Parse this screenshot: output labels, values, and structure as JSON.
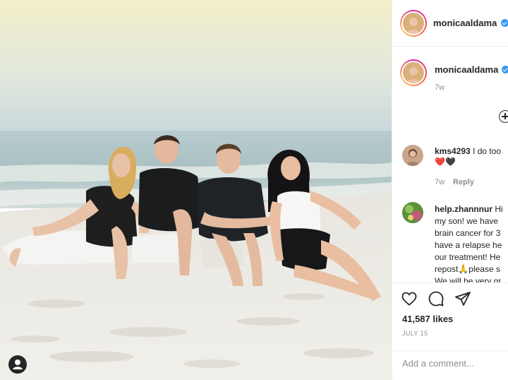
{
  "post": {
    "owner_username": "monicaaldama",
    "time_ago": "7w"
  },
  "comments": [
    {
      "username": "kms4293",
      "lines": [
        "I do too"
      ],
      "emoji": "❤️🖤",
      "time_ago": "7w",
      "reply_label": "Reply"
    },
    {
      "username": "help.zhannnur",
      "lines": [
        "Hi",
        "my son! we have",
        "brain cancer for 3",
        "have a relapse he",
        "our treatment! He",
        "repost🙏please s",
        "We will be very gr"
      ]
    }
  ],
  "actions": {
    "like_icon": "heart-outline-icon",
    "comment_icon": "comment-bubble-icon",
    "share_icon": "paper-plane-icon"
  },
  "likes_text": "41,587 likes",
  "date_text": "JULY 15",
  "add_comment": {
    "placeholder": "Add a comment..."
  },
  "colors": {
    "verified": "#3897f0",
    "divider": "#efefef",
    "meta_gray": "#8e8e8e",
    "text": "#262626"
  }
}
